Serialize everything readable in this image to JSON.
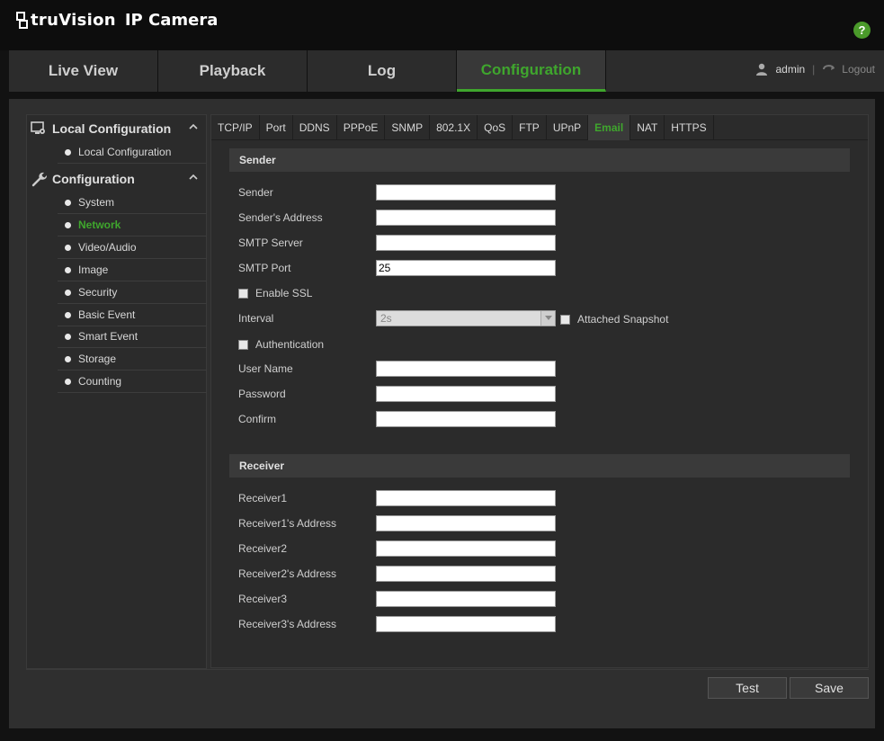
{
  "header": {
    "brand": "truVision",
    "product": "IP Camera",
    "help_label": "?"
  },
  "nav": {
    "tabs": [
      {
        "label": "Live View"
      },
      {
        "label": "Playback"
      },
      {
        "label": "Log"
      },
      {
        "label": "Configuration",
        "active": true
      }
    ],
    "user": "admin",
    "separator": "|",
    "logout": "Logout"
  },
  "sidebar": {
    "local_header": "Local Configuration",
    "local_items": [
      "Local Configuration"
    ],
    "config_header": "Configuration",
    "config_items": [
      "System",
      "Network",
      "Video/Audio",
      "Image",
      "Security",
      "Basic Event",
      "Smart Event",
      "Storage",
      "Counting"
    ],
    "active_item": "Network"
  },
  "subtabs": [
    "TCP/IP",
    "Port",
    "DDNS",
    "PPPoE",
    "SNMP",
    "802.1X",
    "QoS",
    "FTP",
    "UPnP",
    "Email",
    "NAT",
    "HTTPS"
  ],
  "active_subtab": "Email",
  "sender": {
    "title": "Sender",
    "sender_label": "Sender",
    "sender_value": "",
    "address_label": "Sender's Address",
    "address_value": "",
    "smtp_server_label": "SMTP Server",
    "smtp_server_value": "",
    "smtp_port_label": "SMTP Port",
    "smtp_port_value": "25",
    "ssl_label": "Enable SSL",
    "interval_label": "Interval",
    "interval_value": "2s",
    "snapshot_label": "Attached Snapshot",
    "auth_label": "Authentication",
    "username_label": "User Name",
    "username_value": "",
    "password_label": "Password",
    "password_value": "",
    "confirm_label": "Confirm",
    "confirm_value": ""
  },
  "receiver": {
    "title": "Receiver",
    "r1_label": "Receiver1",
    "r1_addr_label": "Receiver1's Address",
    "r2_label": "Receiver2",
    "r2_addr_label": "Receiver2's Address",
    "r3_label": "Receiver3",
    "r3_addr_label": "Receiver3's Address"
  },
  "buttons": {
    "test": "Test",
    "save": "Save"
  },
  "colors": {
    "accent": "#3fa62d",
    "background": "#121212",
    "panel": "#2b2b2b"
  }
}
